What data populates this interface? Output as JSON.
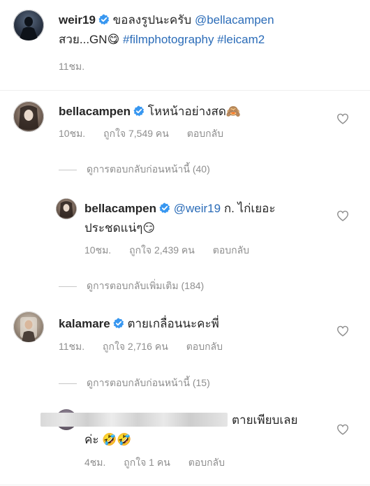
{
  "caption": {
    "username": "weir19",
    "text_prefix": "ขอลงรูปนะครับ",
    "mention": "@bellacampen",
    "line2_prefix": "สวย...GN",
    "emoji": "😋",
    "hashtags": "#filmphotography #leicam2",
    "time": "11ชม."
  },
  "comments": [
    {
      "username": "bellacampen",
      "text": "โหหน้าอย่างสด",
      "emoji": "🙈",
      "time": "10ชม.",
      "likes": "ถูกใจ 7,549 คน",
      "reply": "ตอบกลับ",
      "view_replies": "ดูการตอบกลับก่อนหน้านี้ (40)"
    },
    {
      "username": "bellacampen",
      "mention": "@weir19",
      "text_line1": "ก. ไก่เยอะ",
      "text_line2": "ประชดแน่ๆ",
      "emoji": "😏",
      "time": "10ชม.",
      "likes": "ถูกใจ 2,439 คน",
      "reply": "ตอบกลับ",
      "view_replies": "ดูการตอบกลับเพิ่มเติม (184)"
    },
    {
      "username": "kalamare",
      "text": "ตายเกลื่อนนะคะพี่",
      "time": "11ชม.",
      "likes": "ถูกใจ 2,716 คน",
      "reply": "ตอบกลับ",
      "view_replies": "ดูการตอบกลับก่อนหน้านี้ (15)"
    },
    {
      "text_line1": "ตายเพียบเลย",
      "text_line2": "ค่ะ",
      "emoji": "🤣🤣",
      "time": "4ชม.",
      "likes": "ถูกใจ 1 คน",
      "reply": "ตอบกลับ"
    }
  ],
  "colors": {
    "link": "#2b6cb8",
    "muted": "#8e8e8e",
    "verified": "#3897f0"
  },
  "icons": [
    "verified-badge-icon",
    "heart-outline-icon"
  ]
}
